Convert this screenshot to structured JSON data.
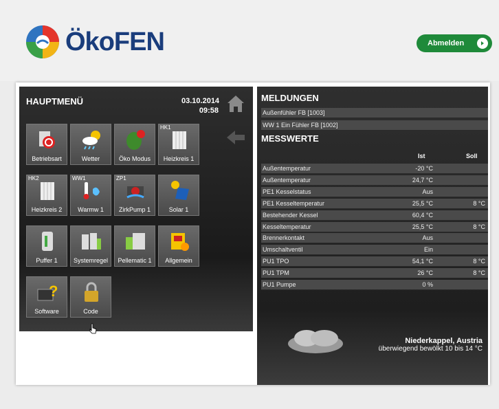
{
  "brand": {
    "name": "ÖkoFEN"
  },
  "header": {
    "logout_label": "Abmelden"
  },
  "left": {
    "title": "HAUPTMENÜ",
    "date": "03.10.2014",
    "time": "09:58",
    "tiles": [
      {
        "label": "Betriebsart",
        "tag": ""
      },
      {
        "label": "Wetter",
        "tag": ""
      },
      {
        "label": "Öko Modus",
        "tag": ""
      },
      {
        "label": "Heizkreis 1",
        "tag": "HK1"
      },
      {
        "label": "Heizkreis 2",
        "tag": "HK2"
      },
      {
        "label": "Warmw 1",
        "tag": "WW1"
      },
      {
        "label": "ZirkPump 1",
        "tag": "ZP1"
      },
      {
        "label": "Solar 1",
        "tag": ""
      },
      {
        "label": "Puffer 1",
        "tag": ""
      },
      {
        "label": "Systemregel",
        "tag": ""
      },
      {
        "label": "Pellematic 1",
        "tag": ""
      },
      {
        "label": "Allgemein",
        "tag": ""
      },
      {
        "label": "Software",
        "tag": ""
      },
      {
        "label": "Code",
        "tag": ""
      }
    ]
  },
  "right": {
    "messages_title": "MELDUNGEN",
    "messages": [
      "Außenfühler FB [1003]",
      "WW 1 Ein Fühler FB [1002]"
    ],
    "values_title": "MESSWERTE",
    "col_ist": "Ist",
    "col_soll": "Soll",
    "rows": [
      {
        "name": "Außentemperatur",
        "ist": "-20 °C",
        "soll": ""
      },
      {
        "name": "Außentemperatur",
        "ist": "24,7 °C",
        "soll": ""
      },
      {
        "name": "PE1 Kesselstatus",
        "ist": "Aus",
        "soll": ""
      },
      {
        "name": "PE1 Kesseltemperatur",
        "ist": "25,5 °C",
        "soll": "8 °C"
      },
      {
        "name": "Bestehender Kessel",
        "ist": "60,4 °C",
        "soll": ""
      },
      {
        "name": "Kesseltemperatur",
        "ist": "25,5 °C",
        "soll": "8 °C"
      },
      {
        "name": "Brennerkontakt",
        "ist": "Aus",
        "soll": ""
      },
      {
        "name": "Umschaltventil",
        "ist": "Ein",
        "soll": ""
      },
      {
        "name": "PU1 TPO",
        "ist": "54,1 °C",
        "soll": "8 °C"
      },
      {
        "name": "PU1 TPM",
        "ist": "26 °C",
        "soll": "8 °C"
      },
      {
        "name": "PU1 Pumpe",
        "ist": "0 %",
        "soll": ""
      }
    ],
    "weather": {
      "city": "Niederkappel, Austria",
      "forecast": "überwiegend bewölkt 10 bis 14 °C"
    }
  },
  "colors": {
    "brand_blue": "#1a3d7c",
    "logout_green": "#1f8a3a",
    "panel_dark": "#2a2a2a"
  }
}
